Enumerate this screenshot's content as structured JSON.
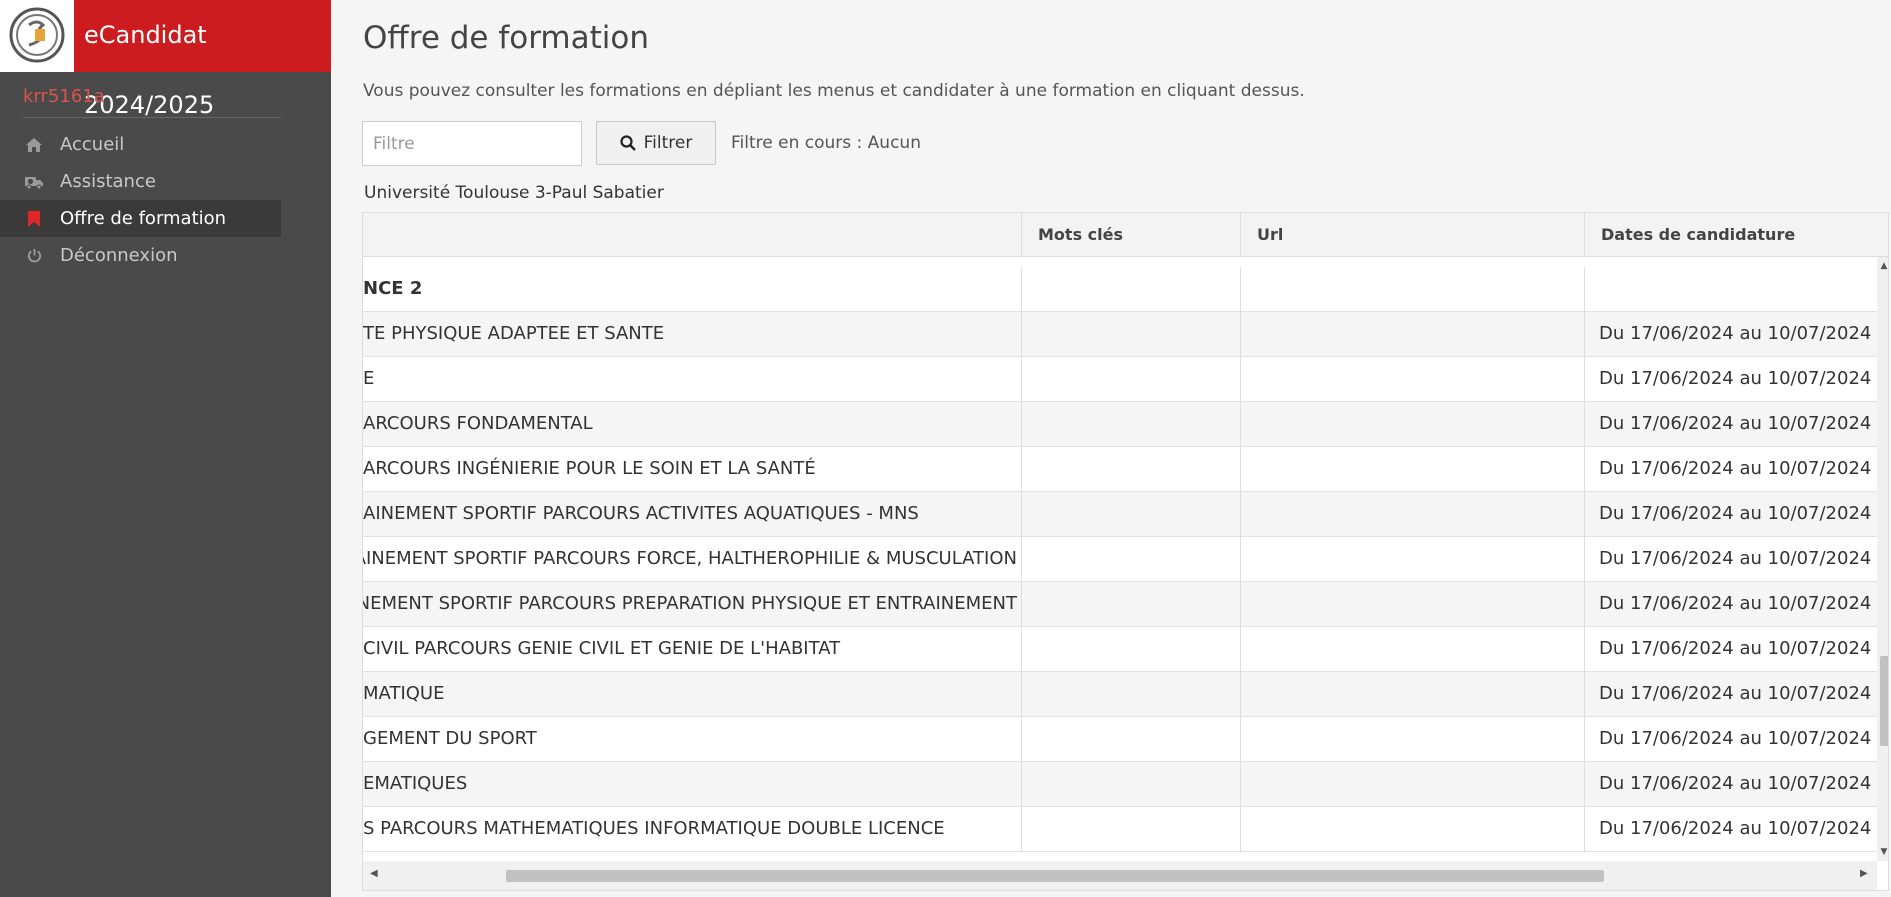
{
  "app": {
    "title": "eCandidat 2024/2025",
    "user": "krr5161a"
  },
  "menu": [
    {
      "label": "Accueil",
      "icon": "home-icon"
    },
    {
      "label": "Assistance",
      "icon": "ambulance-icon"
    },
    {
      "label": "Offre de formation",
      "icon": "bookmark-icon",
      "active": true
    },
    {
      "label": "Déconnexion",
      "icon": "power-icon"
    }
  ],
  "page": {
    "title": "Offre de formation",
    "description": "Vous pouvez consulter les formations en dépliant les menus et candidater à une formation en cliquant dessus.",
    "filter_placeholder": "Filtre",
    "filter_button": "Filtrer",
    "filter_status": "Filtre en cours : Aucun",
    "university": "Université Toulouse 3-Paul Sabatier"
  },
  "table": {
    "columns": [
      "",
      "Mots clés",
      "Url",
      "Dates de candidature"
    ],
    "rows": [
      {
        "name": "NCE 2",
        "date": "",
        "group": true
      },
      {
        "name": "TE PHYSIQUE ADAPTEE ET SANTE",
        "date": "Du 17/06/2024 au 10/07/2024"
      },
      {
        "name": "E",
        "date": "Du 17/06/2024 au 10/07/2024"
      },
      {
        "name": "ARCOURS FONDAMENTAL",
        "date": "Du 17/06/2024 au 10/07/2024"
      },
      {
        "name": "ARCOURS INGÉNIERIE POUR LE SOIN ET LA SANTÉ",
        "date": "Du 17/06/2024 au 10/07/2024"
      },
      {
        "name": "AINEMENT SPORTIF PARCOURS ACTIVITES AQUATIQUES - MNS",
        "date": "Du 17/06/2024 au 10/07/2024"
      },
      {
        "name": "AINEMENT SPORTIF PARCOURS FORCE, HALTHEROPHILIE & MUSCULATION",
        "date": "Du 17/06/2024 au 10/07/2024"
      },
      {
        "name": "AINEMENT SPORTIF PARCOURS PREPARATION PHYSIQUE ET ENTRAINEMENT",
        "date": "Du 17/06/2024 au 10/07/2024"
      },
      {
        "name": " CIVIL PARCOURS GENIE CIVIL ET GENIE DE L'HABITAT",
        "date": "Du 17/06/2024 au 10/07/2024"
      },
      {
        "name": "MATIQUE",
        "date": "Du 17/06/2024 au 10/07/2024"
      },
      {
        "name": "GEMENT DU SPORT",
        "date": "Du 17/06/2024 au 10/07/2024"
      },
      {
        "name": "EMATIQUES",
        "date": "Du 17/06/2024 au 10/07/2024"
      },
      {
        "name": "S PARCOURS MATHEMATIQUES INFORMATIQUE DOUBLE LICENCE",
        "date": "Du 17/06/2024 au 10/07/2024"
      }
    ]
  },
  "colors": {
    "brand": "#cc1c1f",
    "sidebar": "#4a4a4a",
    "active_icon": "#e0282b"
  }
}
